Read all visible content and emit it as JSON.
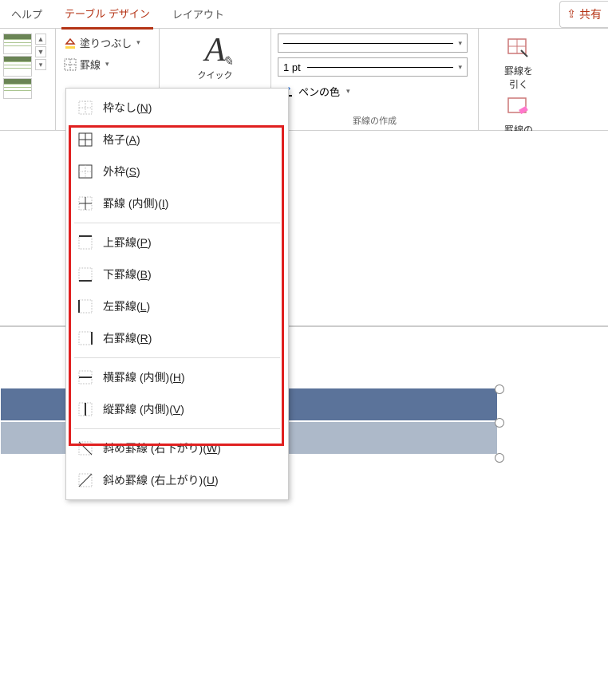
{
  "tabs": {
    "help": "ヘルプ",
    "design": "テーブル デザイン",
    "layout": "レイアウト",
    "share": "共有"
  },
  "ribbon": {
    "fill": "塗りつぶし",
    "borders": "罫線",
    "quick": "クイック",
    "line_weight": "1 pt",
    "pen_color": "ペンの色",
    "draw_group_label": "罫線の作成",
    "draw_border": "罫線を\n引く",
    "erase_border": "罫線の\n削除"
  },
  "menu": {
    "none": "枠なし(",
    "none_k": "N",
    "none_e": ")",
    "all": "格子(",
    "all_k": "A",
    "all_e": ")",
    "outside": "外枠(",
    "outside_k": "S",
    "outside_e": ")",
    "inside": "罫線 (内側)(",
    "inside_k": "I",
    "inside_e": ")",
    "top": "上罫線(",
    "top_k": "P",
    "top_e": ")",
    "bottom": "下罫線(",
    "bottom_k": "B",
    "bottom_e": ")",
    "left": "左罫線(",
    "left_k": "L",
    "left_e": ")",
    "right": "右罫線(",
    "right_k": "R",
    "right_e": ")",
    "inside_h": "横罫線 (内側)(",
    "inside_h_k": "H",
    "inside_h_e": ")",
    "inside_v": "縦罫線 (内側)(",
    "inside_v_k": "V",
    "inside_v_e": ")",
    "diag_down": "斜め罫線 (右下がり)(",
    "diag_down_k": "W",
    "diag_down_e": ")",
    "diag_up": "斜め罫線 (右上がり)(",
    "diag_up_k": "U",
    "diag_up_e": ")"
  }
}
